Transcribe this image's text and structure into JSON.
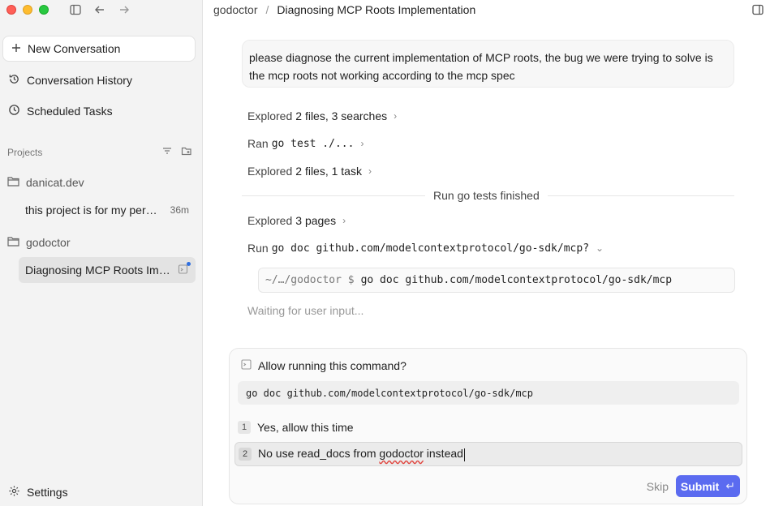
{
  "sidebar": {
    "new_conversation": "New Conversation",
    "conversation_history": "Conversation History",
    "scheduled_tasks": "Scheduled Tasks",
    "projects_label": "Projects",
    "projects": [
      {
        "name": "danicat.dev",
        "conversations": [
          {
            "title": "this project is for my per…",
            "meta": "36m"
          }
        ]
      },
      {
        "name": "godoctor",
        "conversations": [
          {
            "title": "Diagnosing MCP Roots Im…",
            "meta": ""
          }
        ]
      }
    ],
    "settings": "Settings"
  },
  "header": {
    "project": "godoctor",
    "title": "Diagnosing MCP Roots Implementation"
  },
  "main": {
    "user_message": "please diagnose the current implementation of MCP roots, the bug we were trying to solve is the mcp roots not working according to the mcp spec",
    "steps": [
      {
        "verb": "Explored",
        "detail": "2 files, 3 searches"
      },
      {
        "verb": "Ran",
        "detail": "go test ./..."
      },
      {
        "verb": "Explored",
        "detail": "2 files, 1 task"
      }
    ],
    "divider_label": "Run go tests finished",
    "step4": {
      "verb": "Explored",
      "detail": "3 pages"
    },
    "step5": {
      "verb": "Run",
      "detail": "go doc github.com/modelcontextprotocol/go-sdk/mcp?"
    },
    "terminal": {
      "prompt": "~/…/godoctor $",
      "command": "go doc github.com/modelcontextprotocol/go-sdk/mcp"
    },
    "waiting": "Waiting for user input..."
  },
  "permission": {
    "title": "Allow running this command?",
    "command": "go doc github.com/modelcontextprotocol/go-sdk/mcp",
    "option1_num": "1",
    "option1": "Yes, allow this time",
    "option2_num": "2",
    "option2_before": "No use read_docs from ",
    "option2_underlined": "godoctor",
    "option2_after": " instead",
    "skip": "Skip",
    "submit": "Submit",
    "submit_icon": "↵"
  }
}
